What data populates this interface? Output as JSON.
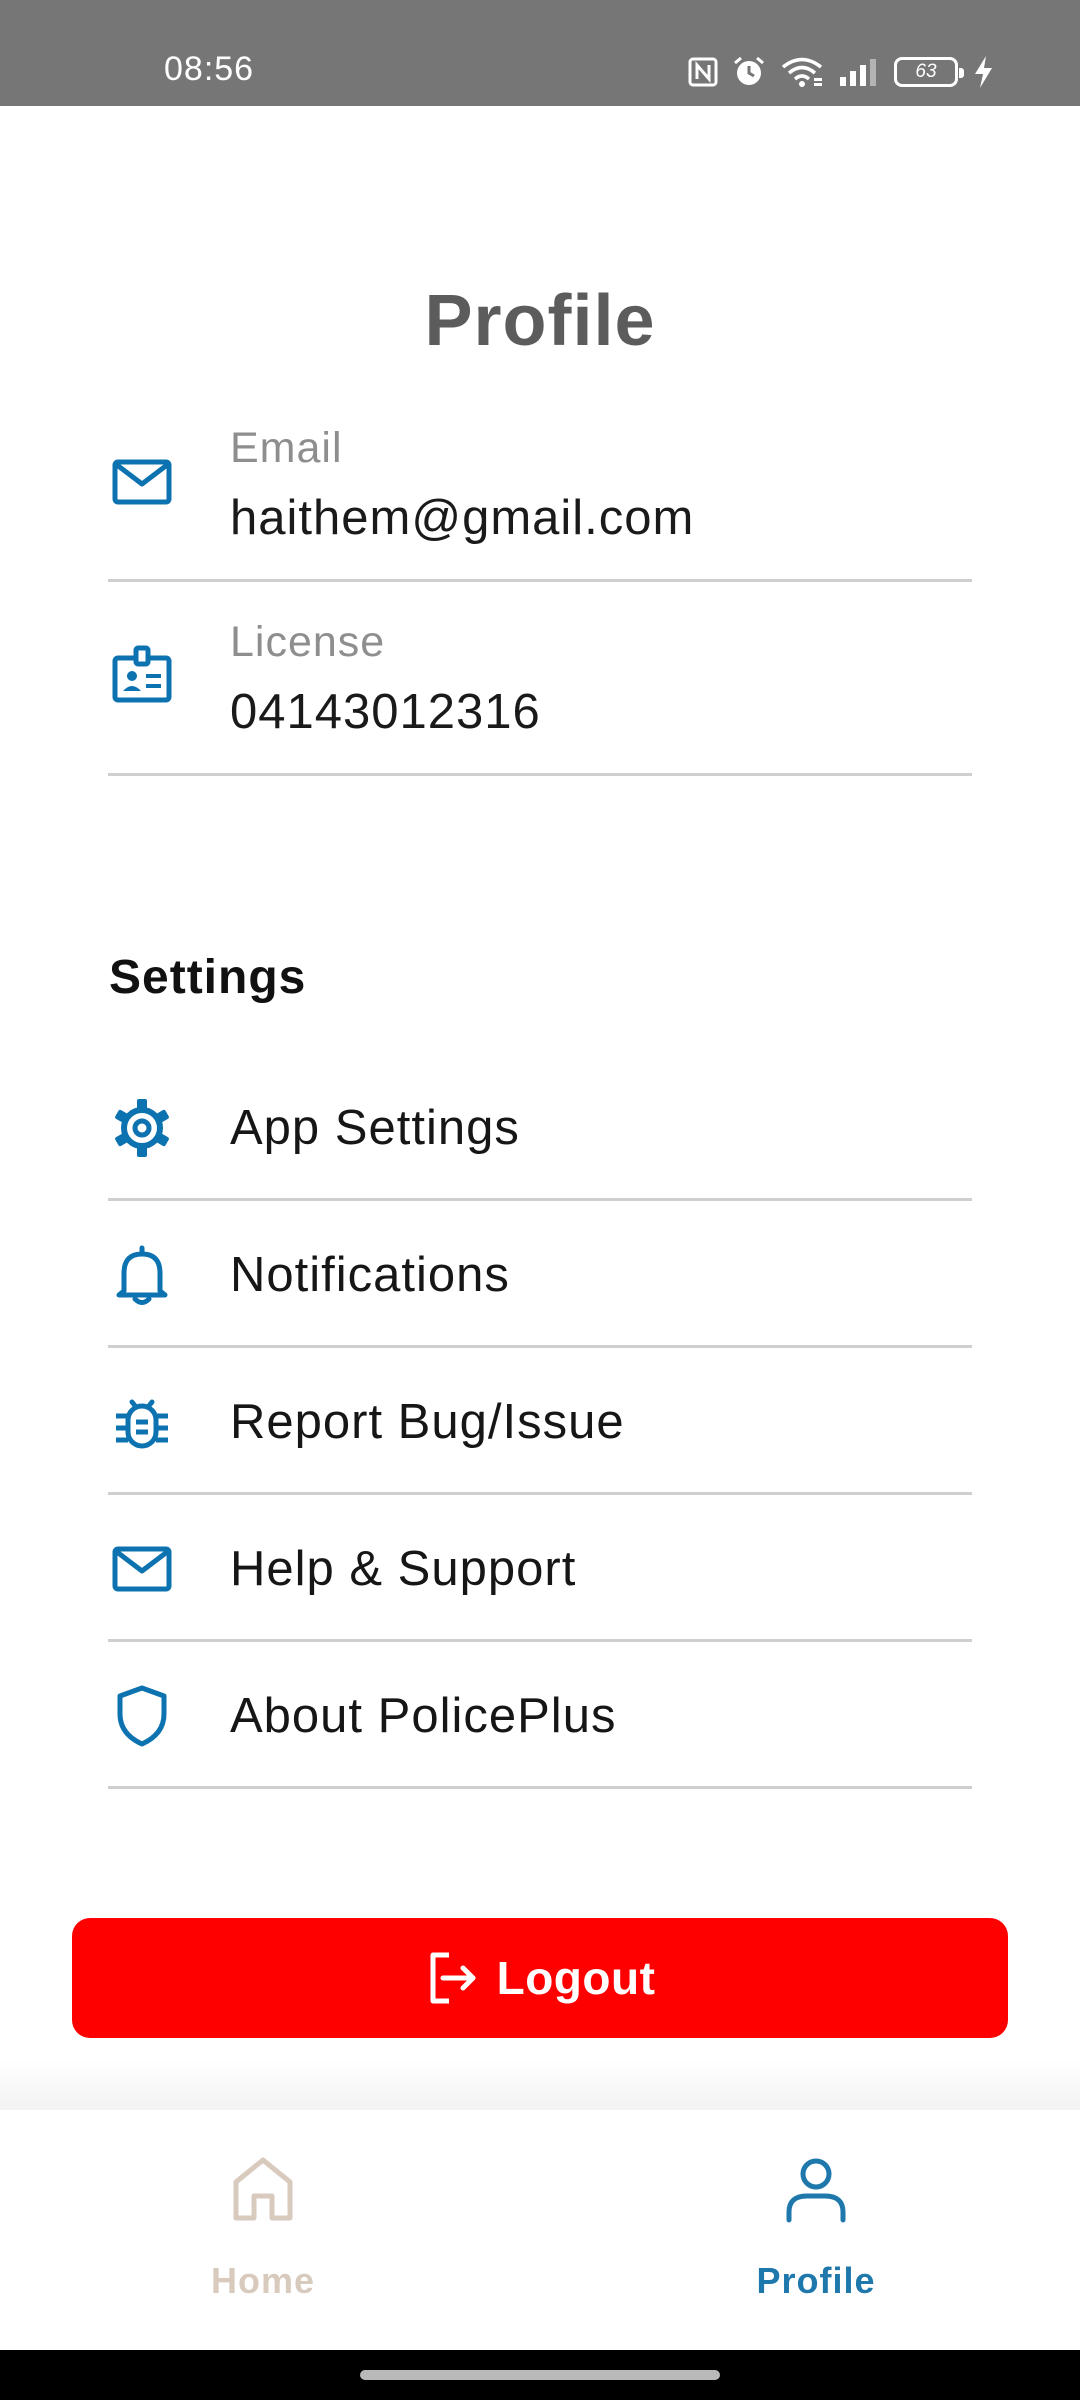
{
  "status_bar": {
    "time": "08:56",
    "battery_level": "63",
    "icons": [
      "nfc-icon",
      "alarm-icon",
      "wifi-icon",
      "signal-icon",
      "battery-icon",
      "charging-icon"
    ]
  },
  "header": {
    "title": "Profile"
  },
  "profile": {
    "email": {
      "label": "Email",
      "value": "haithem@gmail.com",
      "icon": "mail-icon"
    },
    "license": {
      "label": "License",
      "value": "04143012316",
      "icon": "id-badge-icon"
    }
  },
  "settings": {
    "heading": "Settings",
    "items": [
      {
        "label": "App Settings",
        "icon": "gear-icon"
      },
      {
        "label": "Notifications",
        "icon": "bell-icon"
      },
      {
        "label": "Report Bug/Issue",
        "icon": "bug-icon"
      },
      {
        "label": "Help & Support",
        "icon": "mail-icon"
      },
      {
        "label": "About PolicePlus",
        "icon": "shield-icon"
      }
    ]
  },
  "logout": {
    "label": "Logout",
    "icon": "logout-icon"
  },
  "bottom_nav": {
    "items": [
      {
        "label": "Home",
        "icon": "home-icon",
        "active": false
      },
      {
        "label": "Profile",
        "icon": "person-icon",
        "active": true
      }
    ]
  },
  "colors": {
    "accent": "#1e78ac",
    "icon_blue": "#0c72b0",
    "logout_red": "#ff0000",
    "inactive_nav": "#d8cabd",
    "status_bar": "#767676",
    "title_gray": "#5c5c5c"
  }
}
